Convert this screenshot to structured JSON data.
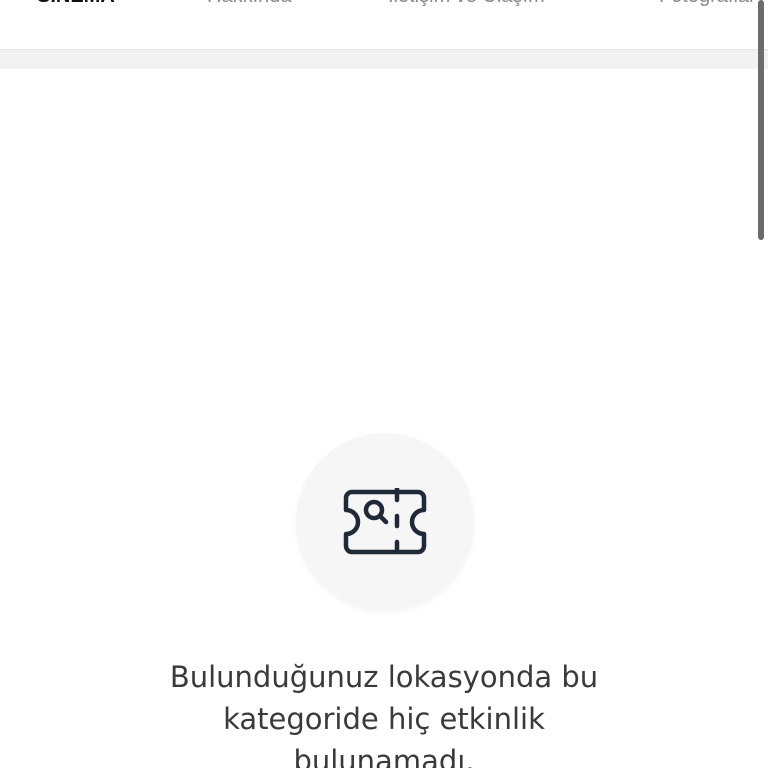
{
  "tabs": [
    {
      "label": "SİNEMA",
      "active": true
    },
    {
      "label": "Hakkında",
      "active": false
    },
    {
      "label": "İletişim ve Ulaşım",
      "active": false
    },
    {
      "label": "Fotoğraflar",
      "active": false
    }
  ],
  "empty_state": {
    "icon": "ticket-search-icon",
    "message": "Bulunduğunuz lokasyonda bu kategoride hiç etkinlik bulunamadı."
  },
  "colors": {
    "active_tab": "#111111",
    "inactive_tab": "#8a8a8a",
    "icon": "#1f2937",
    "message_text": "#3a3a3a"
  }
}
